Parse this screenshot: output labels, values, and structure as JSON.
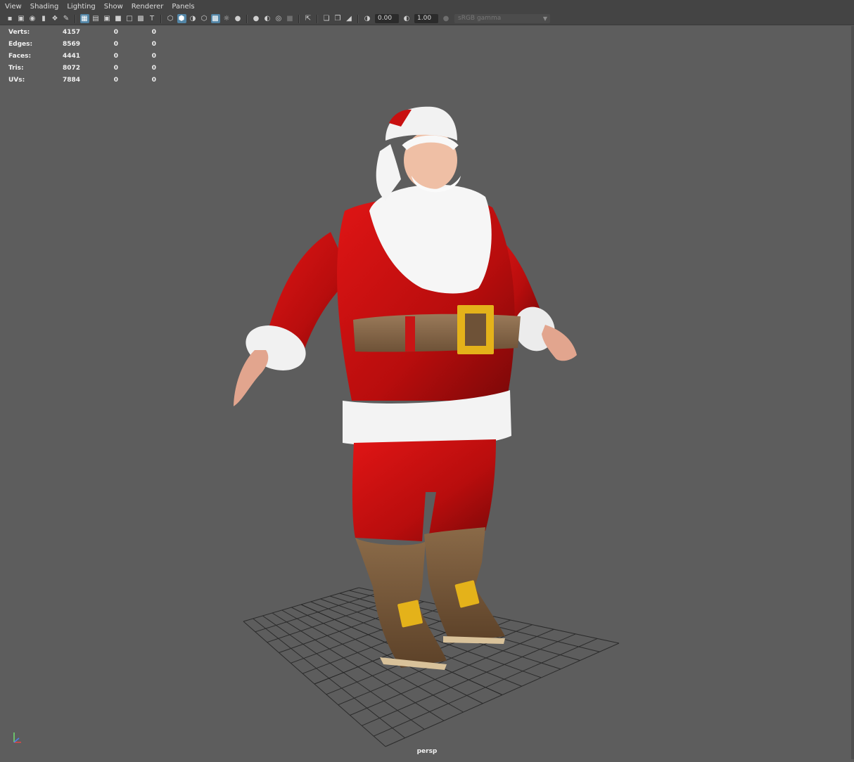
{
  "menu": [
    "View",
    "Shading",
    "Lighting",
    "Show",
    "Renderer",
    "Panels"
  ],
  "toolbar": {
    "exposure": "0.00",
    "gamma": "1.00",
    "color_space": "sRGB gamma"
  },
  "hud": {
    "rows": [
      {
        "label": "Verts:",
        "value": "4157",
        "col2": "0",
        "col3": "0"
      },
      {
        "label": "Edges:",
        "value": "8569",
        "col2": "0",
        "col3": "0"
      },
      {
        "label": "Faces:",
        "value": "4441",
        "col2": "0",
        "col3": "0"
      },
      {
        "label": "Tris:",
        "value": "8072",
        "col2": "0",
        "col3": "0"
      },
      {
        "label": "UVs:",
        "value": "7884",
        "col2": "0",
        "col3": "0"
      }
    ]
  },
  "viewport": {
    "camera": "persp",
    "background_color": "#5d5d5d",
    "grid_color": "#2a2a2a"
  }
}
